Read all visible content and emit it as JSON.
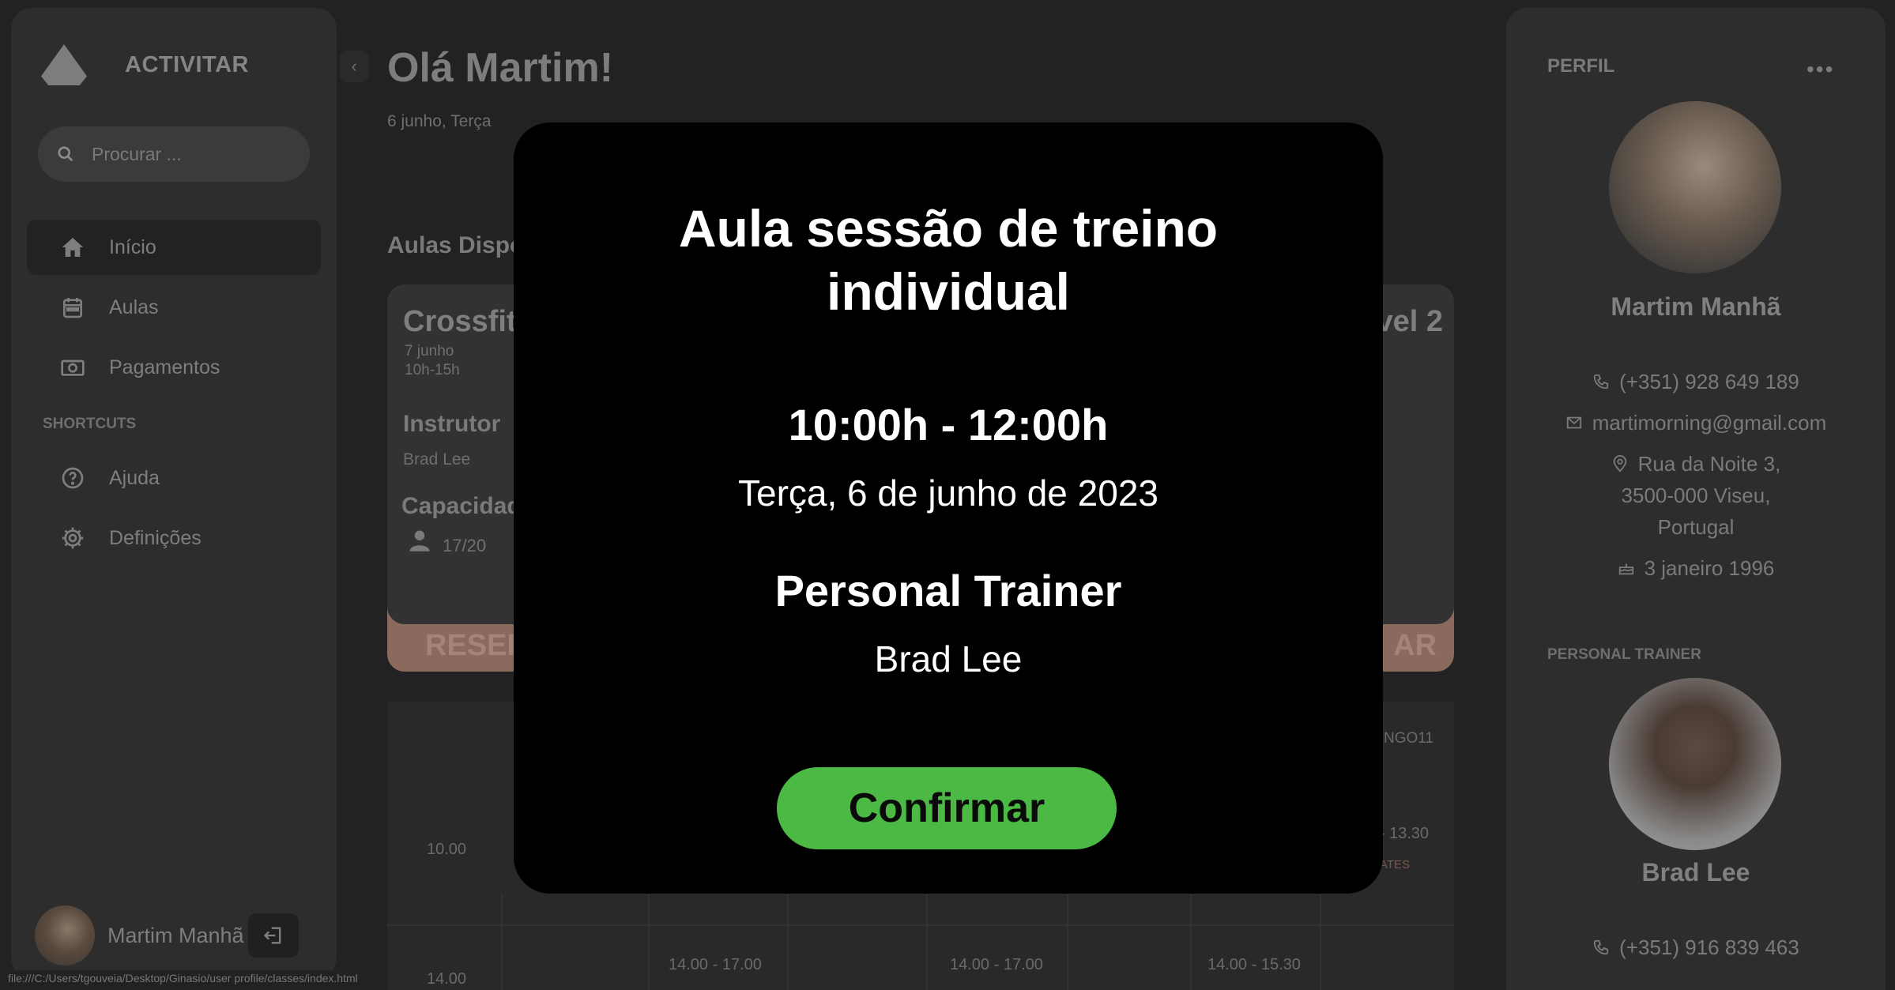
{
  "app": {
    "logo_text": "ACTIVITAR"
  },
  "search": {
    "placeholder": "Procurar ..."
  },
  "sidebar": {
    "items": [
      {
        "label": "Início",
        "icon": "home-icon",
        "active": true
      },
      {
        "label": "Aulas",
        "icon": "calendar-icon"
      },
      {
        "label": "Pagamentos",
        "icon": "payment-icon"
      }
    ],
    "shortcuts_label": "SHORTCUTS",
    "shortcuts": [
      {
        "label": "Ajuda",
        "icon": "help-icon"
      },
      {
        "label": "Definições",
        "icon": "gear-icon"
      }
    ],
    "user_name": "Martim Manhã"
  },
  "main": {
    "greeting": "Olá Martim!",
    "date": "6 junho, Terça",
    "section_title": "Aulas Disponíveis",
    "card": {
      "title": "Crossfit",
      "title_right": "vel 2",
      "date": "7 junho",
      "time": "10h-15h",
      "instructor_heading": "Instrutor",
      "instructor": "Brad Lee",
      "capacity_heading": "Capacidade",
      "capacity": "17/20",
      "button_left": "RESERVAR",
      "button_right": "AR"
    },
    "schedule": {
      "code": "NGO11",
      "rows": [
        "10.00",
        "14.00"
      ],
      "right_slot": "- 13.30",
      "right_slot_sub": "ATES",
      "slots_row2": [
        "14.00 - 17.00",
        "14.00 - 17.00",
        "14.00 - 15.30"
      ]
    }
  },
  "profile": {
    "heading": "PERFIL",
    "name": "Martim Manhã",
    "phone": "(+351) 928 649 189",
    "email": "martimorning@gmail.com",
    "address_1": "Rua da Noite 3,",
    "address_2": "3500-000 Viseu,",
    "address_3": "Portugal",
    "birthday": "3 janeiro 1996",
    "trainer_heading": "PERSONAL TRAINER",
    "trainer_name": "Brad Lee",
    "trainer_phone": "(+351) 916 839 463"
  },
  "modal": {
    "title_line1": "Aula sessão de treino",
    "title_line2": "individual",
    "time": "10:00h - 12:00h",
    "date": "Terça, 6 de junho de 2023",
    "role": "Personal Trainer",
    "trainer": "Brad Lee",
    "confirm_label": "Confirmar",
    "confirm_color": "#4cb944"
  },
  "status_bar": {
    "url": "file:///C:/Users/tgouveia/Desktop/Ginasio/user profile/classes/index.html"
  }
}
